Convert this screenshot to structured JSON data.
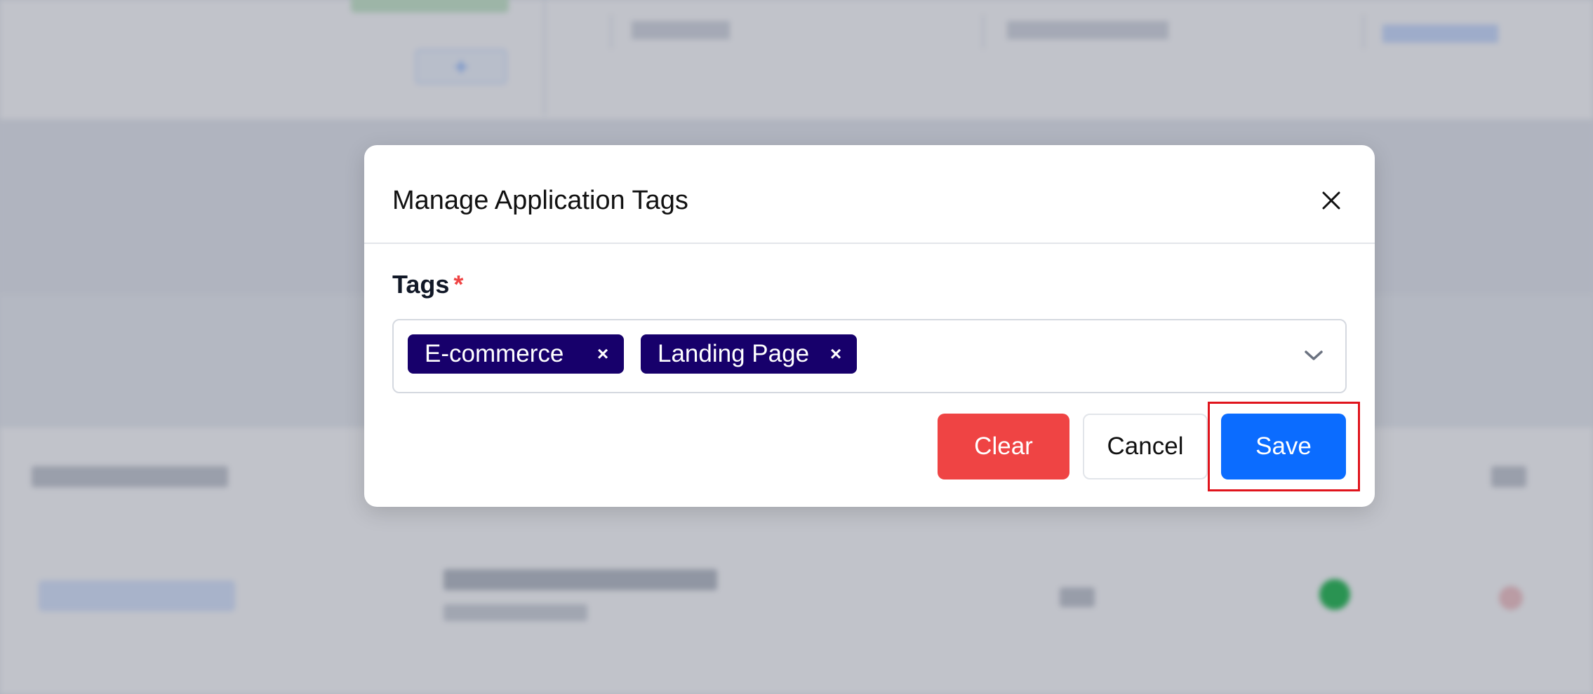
{
  "modal": {
    "title": "Manage Application Tags",
    "close_icon": "close-icon",
    "field_label": "Tags",
    "required_marker": "*",
    "tags": [
      {
        "label": "E-commerce",
        "remove_symbol": "×"
      },
      {
        "label": "Landing Page",
        "remove_symbol": "×"
      }
    ],
    "dropdown_icon": "chevron-down-icon",
    "buttons": {
      "clear": "Clear",
      "cancel": "Cancel",
      "save": "Save"
    },
    "colors": {
      "tag_bg": "#17006b",
      "clear_bg": "#ef4444",
      "save_bg": "#0b6cff",
      "highlight": "#e0141c"
    }
  }
}
